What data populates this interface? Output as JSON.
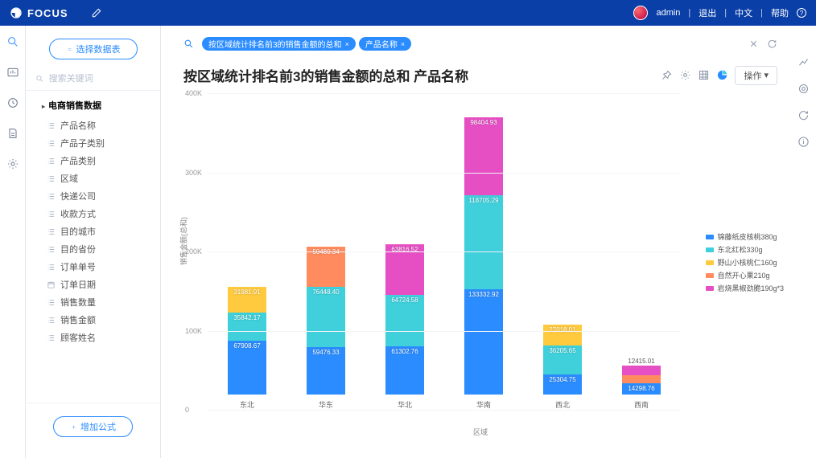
{
  "app": {
    "brand": "FOCUS"
  },
  "topbar": {
    "user": "admin",
    "logout": "退出",
    "lang": "中文",
    "help": "帮助"
  },
  "sidebar": {
    "select_datasource": "选择数据表",
    "search_placeholder": "搜索关键词",
    "dataset": "电商销售数据",
    "fields": [
      "产品名称",
      "产品子类别",
      "产品类别",
      "区域",
      "快递公司",
      "收款方式",
      "目的城市",
      "目的省份",
      "订单单号",
      "订单日期",
      "销售数量",
      "销售金额",
      "顾客姓名"
    ],
    "add_formula": "增加公式"
  },
  "query": {
    "pill1": "按区域统计排名前3的销售金额的总和",
    "pill2": "产品名称"
  },
  "chart": {
    "title": "按区域统计排名前3的销售金额的总和 产品名称",
    "ops": "操作"
  },
  "chart_data": {
    "type": "bar",
    "stacked": true,
    "xlabel": "区域",
    "ylabel": "销售金额(总和)",
    "ylim": [
      0,
      400000
    ],
    "yticks": [
      0,
      100000,
      200000,
      300000,
      400000
    ],
    "ytick_labels": [
      "0",
      "100K",
      "200K",
      "300K",
      "400K"
    ],
    "categories": [
      "东北",
      "华东",
      "华北",
      "华南",
      "西北",
      "西南"
    ],
    "series_colors": {
      "锦藤纸皮核桃380g": "#2a8cff",
      "东北红松330g": "#3fd0db",
      "野山小核桃仁160g": "#ffca3e",
      "自然开心果210g": "#ff8b5f",
      "岩烧黑椒劲脆190g*3": "#e64fc4"
    },
    "legend_order": [
      "锦藤纸皮核桃380g",
      "东北红松330g",
      "野山小核桃仁160g",
      "自然开心果210g",
      "岩烧黑椒劲脆190g*3"
    ],
    "stacks": {
      "东北": [
        [
          "锦藤纸皮核桃380g",
          67908.67
        ],
        [
          "东北红松330g",
          35842.17
        ],
        [
          "野山小核桃仁160g",
          31981.91
        ]
      ],
      "华东": [
        [
          "锦藤纸皮核桃380g",
          59476.33
        ],
        [
          "东北红松330g",
          76448.4
        ],
        [
          "自然开心果210g",
          50480.34
        ]
      ],
      "华北": [
        [
          "锦藤纸皮核桃380g",
          61302.76
        ],
        [
          "东北红松330g",
          64724.58
        ],
        [
          "岩烧黑椒劲脆190g*3",
          63816.52
        ]
      ],
      "华南": [
        [
          "锦藤纸皮核桃380g",
          133332.92
        ],
        [
          "东北红松330g",
          118705.29
        ],
        [
          "岩烧黑椒劲脆190g*3",
          98404.93
        ]
      ],
      "西北": [
        [
          "锦藤纸皮核桃380g",
          25304.75
        ],
        [
          "东北红松330g",
          36205.65
        ],
        [
          "野山小核桃仁160g",
          27018.01
        ]
      ],
      "西南": [
        [
          "锦藤纸皮核桃380g",
          14298.76
        ],
        [
          "自然开心果210g",
          9749.46
        ],
        [
          "岩烧黑椒劲脆190g*3",
          12415.01
        ]
      ]
    }
  }
}
